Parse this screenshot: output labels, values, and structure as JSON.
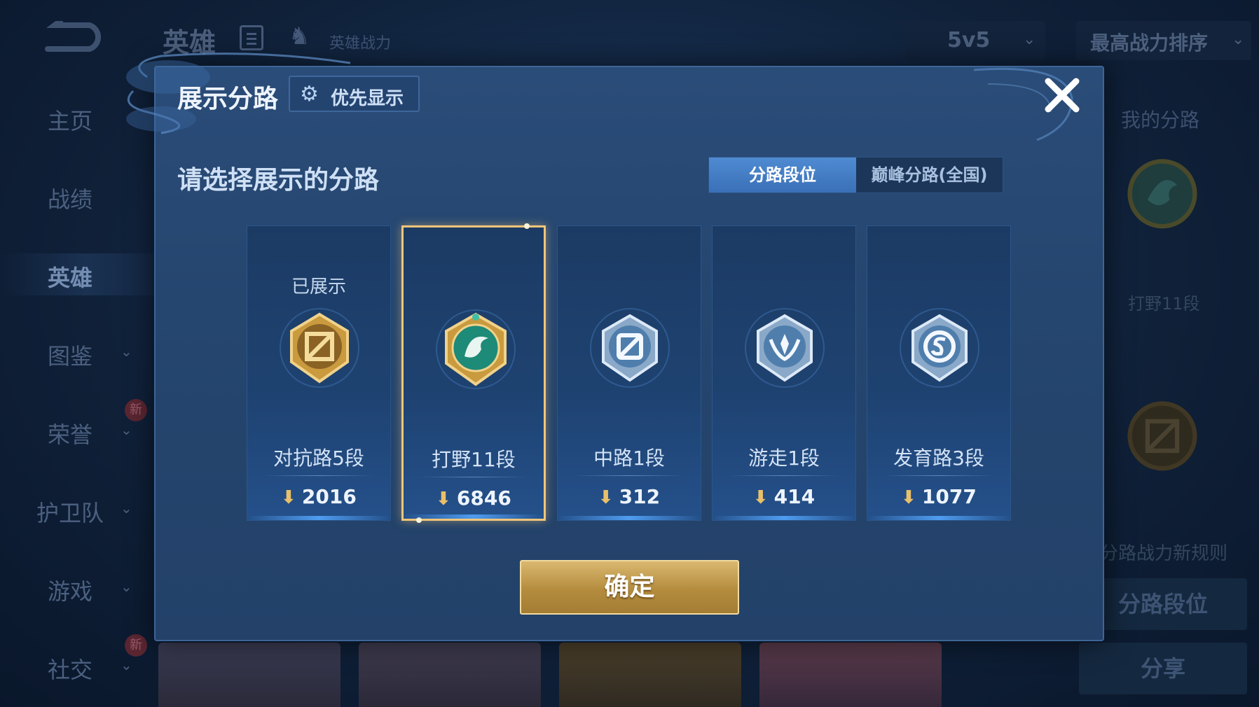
{
  "background": {
    "top_title": "英雄",
    "power_label": "英雄战力",
    "mode_select": "5v5",
    "sort_select": "最高战力排序",
    "sidebar": [
      {
        "label": "主页",
        "dropdown": false,
        "new": false
      },
      {
        "label": "战绩",
        "dropdown": false,
        "new": false
      },
      {
        "label": "英雄",
        "dropdown": false,
        "new": false,
        "active": true
      },
      {
        "label": "图鉴",
        "dropdown": true,
        "new": false
      },
      {
        "label": "荣誉",
        "dropdown": true,
        "new": true
      },
      {
        "label": "护卫队",
        "dropdown": true,
        "new": false
      },
      {
        "label": "游戏",
        "dropdown": true,
        "new": false
      },
      {
        "label": "社交",
        "dropdown": true,
        "new": true
      }
    ],
    "new_badge": "新",
    "right_panel": {
      "title": "我的分路",
      "current_rank": "打野11段",
      "rule_link": "分路战力新规则",
      "lane_rank_button": "分路段位",
      "share_button": "分享"
    }
  },
  "modal": {
    "title": "展示分路",
    "priority_button": "优先显示",
    "prompt": "请选择展示的分路",
    "segment": {
      "options": [
        "分路段位",
        "巅峰分路(全国)"
      ],
      "selected": 0
    },
    "lanes": [
      {
        "name": "对抗路5段",
        "score": "2016",
        "status": "已展示",
        "icon": "clash-lane-badge-icon",
        "tier": "gold"
      },
      {
        "name": "打野11段",
        "score": "6846",
        "status": "",
        "icon": "jungle-dragon-badge-icon",
        "tier": "gold-emerald",
        "selected": true
      },
      {
        "name": "中路1段",
        "score": "312",
        "status": "",
        "icon": "mid-lane-badge-icon",
        "tier": "silver"
      },
      {
        "name": "游走1段",
        "score": "414",
        "status": "",
        "icon": "roam-badge-icon",
        "tier": "silver"
      },
      {
        "name": "发育路3段",
        "score": "1077",
        "status": "",
        "icon": "farm-lane-badge-icon",
        "tier": "silver"
      }
    ],
    "confirm_button": "确定"
  },
  "colors": {
    "gold": "#e9c06a",
    "selected_border": "#f1c57a",
    "segment_active": "#4f8bd2",
    "modal_bg": "#27476f"
  }
}
